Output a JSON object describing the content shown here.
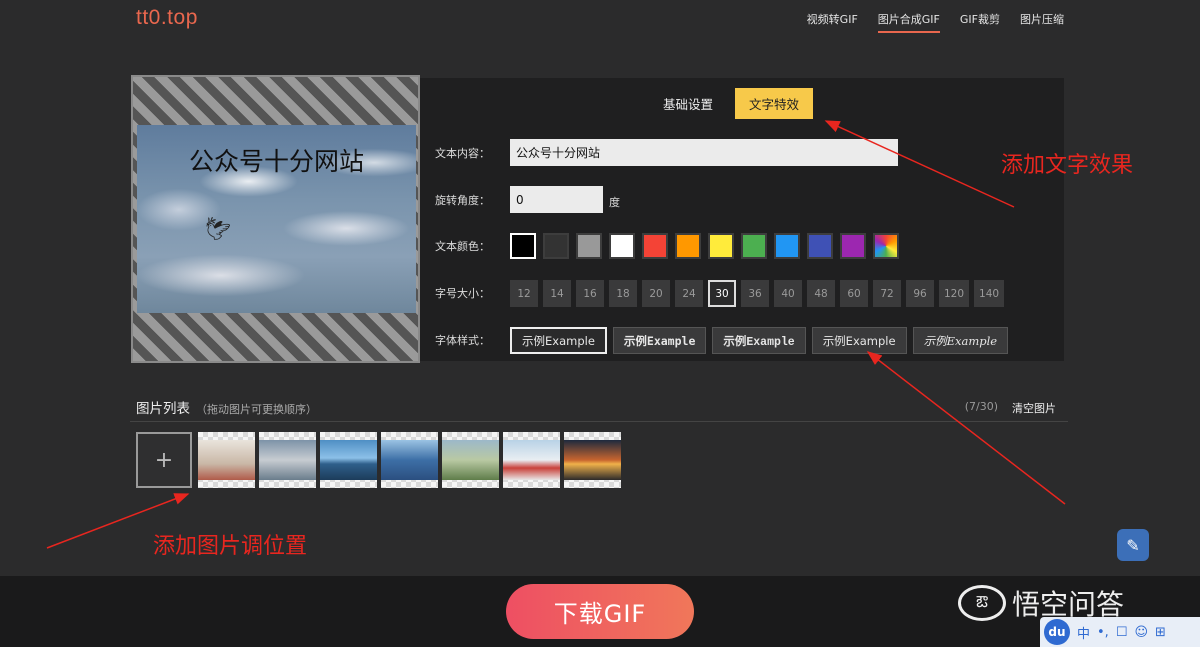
{
  "header": {
    "logo": "tt0.top",
    "nav": [
      "视频转GIF",
      "图片合成GIF",
      "GIF裁剪",
      "图片压缩"
    ],
    "active_nav": 1
  },
  "preview": {
    "overlay_text": "公众号十分网站",
    "bird": "🕊"
  },
  "panel": {
    "tabs": [
      "基础设置",
      "文字特效"
    ],
    "labels": {
      "text": "文本内容：",
      "rotate": "旋转角度：",
      "color": "文本颜色：",
      "size": "字号大小：",
      "font": "字体样式："
    },
    "text_value": "公众号十分网站",
    "rotate_value": "0",
    "rotate_unit": "度",
    "colors": [
      "#000000",
      "#333333",
      "#999999",
      "#ffffff",
      "#f44336",
      "#ff9800",
      "#ffeb3b",
      "#4caf50",
      "#2196f3",
      "#3f51b5",
      "#9c27b0",
      "rainbow"
    ],
    "sizes": [
      "12",
      "14",
      "16",
      "18",
      "20",
      "24",
      "30",
      "36",
      "40",
      "48",
      "60",
      "72",
      "96",
      "120",
      "140"
    ],
    "selected_size": "30",
    "fonts": [
      "示例Example",
      "示例Example",
      "示例Example",
      "示例Example",
      "示例Example"
    ]
  },
  "image_list": {
    "title": "图片列表",
    "hint": "（拖动图片可更换顺序）",
    "count": "(7/30)",
    "clear_label": "清空图片",
    "add_symbol": "+",
    "thumbs": [
      "linear-gradient(180deg,#e9e4dc,#c9b7a6 60%,#b05b4a)",
      "linear-gradient(180deg,#7d93a8,#c7ccd1 50%,#6a7d8c)",
      "linear-gradient(180deg,#4f8fc4 0,#8cc0e8 45%,#2f5f8a 60%,#1c3c5a)",
      "linear-gradient(180deg,#9bc3e3,#3d6fa6 50%,#2b4f80)",
      "linear-gradient(180deg,#9cb8c9,#b9c9a3 50%,#5f7d4a)",
      "linear-gradient(180deg,#b9d2e6,#e9eef2 50%,#c9413a 70%,#e8e8e8)",
      "linear-gradient(180deg,#1d2a3e,#c7652f 50%,#f0b14a 60%,#2c2a2a)"
    ]
  },
  "annotations": {
    "text_effect": "添加文字效果",
    "adjust_images": "添加图片调位置"
  },
  "download_label": "下载GIF",
  "watermark": {
    "logo": "ఔ",
    "text": "悟空问答"
  },
  "side_icon": "✎",
  "ime": {
    "logo": "du",
    "items": [
      "中",
      "•,",
      "☐",
      "☺",
      "⊞"
    ]
  }
}
